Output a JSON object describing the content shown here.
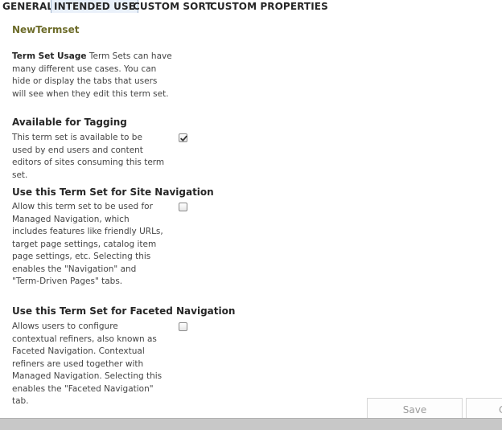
{
  "tabs": [
    {
      "label": "GENERAL",
      "active": false
    },
    {
      "label": "INTENDED USE",
      "active": true
    },
    {
      "label": "CUSTOM SORT",
      "active": false
    },
    {
      "label": "CUSTOM PROPERTIES",
      "active": false
    }
  ],
  "termset_name": "NewTermset",
  "usage": {
    "label": "Term Set Usage",
    "text": "Term Sets can have many different use cases. You can hide or display the tabs that users will see when they edit this term set."
  },
  "sections": [
    {
      "heading": "Available for Tagging",
      "description": "This term set is available to be used by end users and content editors of sites consuming this term set.",
      "checked": true
    },
    {
      "heading": "Use this Term Set for Site Navigation",
      "description": "Allow this term set to be used for Managed Navigation, which includes features like friendly URLs, target page settings, catalog item page settings, etc. Selecting this enables the \"Navigation\" and \"Term-Driven Pages\" tabs.",
      "checked": false
    },
    {
      "heading": "Use this Term Set for Faceted Navigation",
      "description": "Allows users to configure contextual refiners, also known as Faceted Navigation. Contextual refiners are used together with Managed Navigation. Selecting this enables the \"Faceted Navigation\" tab.",
      "checked": false
    }
  ],
  "buttons": {
    "save": "Save",
    "cancel": "C"
  },
  "colors": {
    "title": "#6d6c2a",
    "text": "#444444",
    "heading": "#262626"
  }
}
